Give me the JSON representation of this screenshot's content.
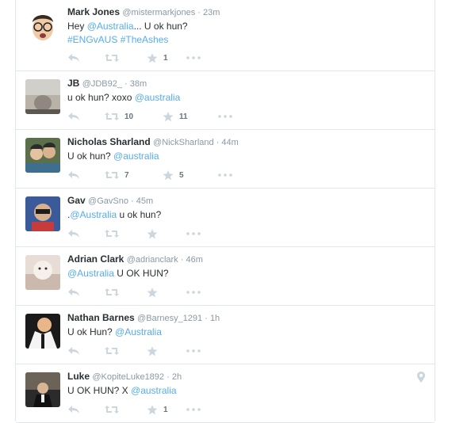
{
  "tweets": [
    {
      "name": "Mark Jones",
      "handle": "@mistermarkjones",
      "sep": " · ",
      "time": "23m",
      "text": [
        {
          "t": "Hey "
        },
        {
          "t": "@Australia",
          "link": true
        },
        {
          "t": "... U ok hun?"
        }
      ],
      "text2": [
        {
          "t": "#ENGvAUS",
          "link": true
        },
        {
          "t": " "
        },
        {
          "t": "#TheAshes",
          "link": true
        }
      ],
      "retweets": "",
      "favorites": "1",
      "avatar_color": "#d9d9d9"
    },
    {
      "name": "JB",
      "handle": "@JDB92_",
      "sep": " · ",
      "time": "38m",
      "text": [
        {
          "t": "u ok hun? xoxo "
        },
        {
          "t": "@australia",
          "link": true
        }
      ],
      "retweets": "10",
      "favorites": "11",
      "avatar_color": "#b8b2a8"
    },
    {
      "name": "Nicholas Sharland",
      "handle": "@NickSharland",
      "sep": " · ",
      "time": "44m",
      "text": [
        {
          "t": "U ok hun? "
        },
        {
          "t": "@australia",
          "link": true
        }
      ],
      "retweets": "7",
      "favorites": "5",
      "avatar_color": "#5a6f4a"
    },
    {
      "name": "Gav",
      "handle": "@GavSno",
      "sep": " · ",
      "time": "45m",
      "text": [
        {
          "t": "."
        },
        {
          "t": "@Australia",
          "link": true
        },
        {
          "t": " u ok hun?"
        }
      ],
      "retweets": "",
      "favorites": "",
      "avatar_color": "#3b5a9a"
    },
    {
      "name": "Adrian Clark",
      "handle": "@adrianclark",
      "sep": " · ",
      "time": "46m",
      "text": [
        {
          "t": "@Australia",
          "link": true
        },
        {
          "t": " U OK HUN?"
        }
      ],
      "retweets": "",
      "favorites": "",
      "avatar_color": "#e8ddd6"
    },
    {
      "name": "Nathan Barnes",
      "handle": "@Barnesy_1291",
      "sep": " · ",
      "time": "1h",
      "text": [
        {
          "t": "U ok Hun? "
        },
        {
          "t": "@Australia",
          "link": true
        }
      ],
      "retweets": "",
      "favorites": "",
      "avatar_color": "#1a1a1a"
    },
    {
      "name": "Luke",
      "handle": "@KopiteLuke1892",
      "sep": " · ",
      "time": "2h",
      "text": [
        {
          "t": "U OK HUN? X "
        },
        {
          "t": "@australia",
          "link": true
        }
      ],
      "retweets": "",
      "favorites": "1",
      "avatar_color": "#2b2b2b",
      "has_location_pin": true
    }
  ],
  "icons": {
    "reply": "reply-icon",
    "retweet": "retweet-icon",
    "favorite": "star-icon",
    "more": "more-icon",
    "location": "location-pin-icon"
  },
  "colors": {
    "link": "#55acee",
    "action_icon": "#ccd6dd",
    "meta": "#8899a6",
    "count": "#66757f",
    "divider": "#e1e8ed"
  }
}
